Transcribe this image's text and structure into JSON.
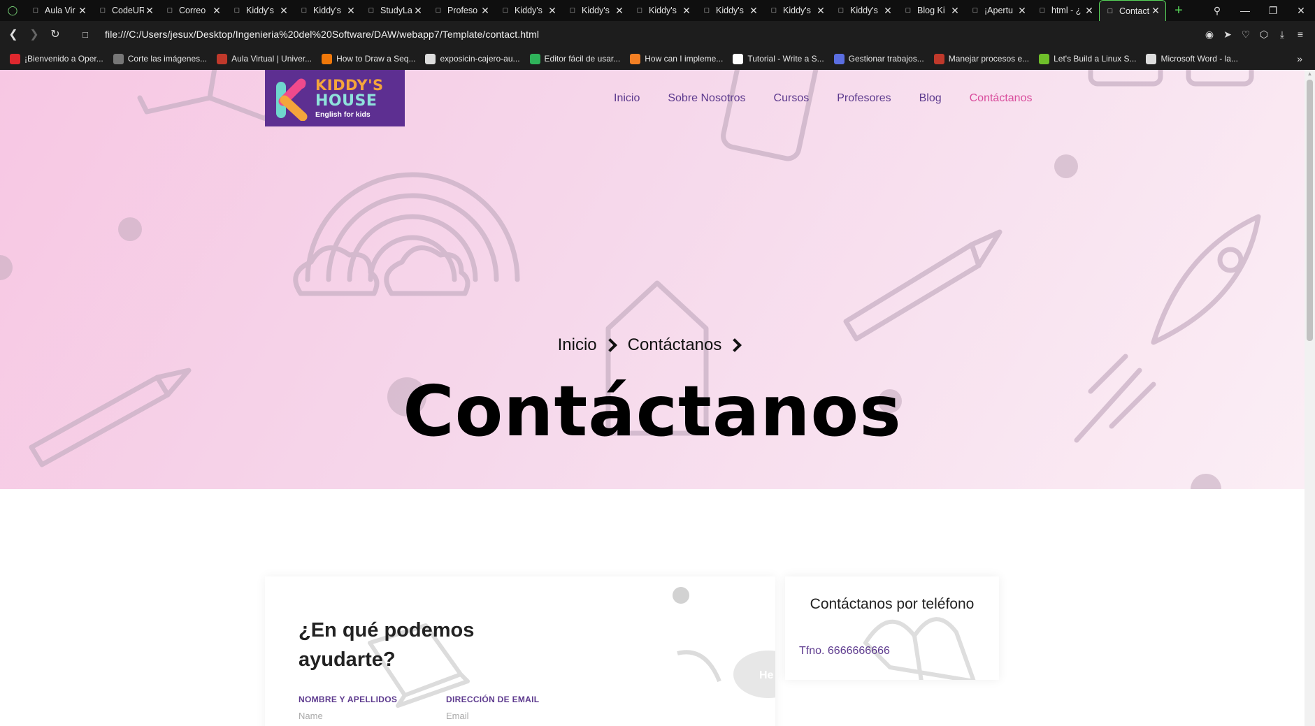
{
  "browser": {
    "tabs": [
      {
        "title": "Aula Vir",
        "icon": "moodle-icon"
      },
      {
        "title": "CodeUR",
        "icon": "github-icon"
      },
      {
        "title": "Correo",
        "icon": "outlook-icon"
      },
      {
        "title": "Kiddy's",
        "icon": "page-icon"
      },
      {
        "title": "Kiddy's",
        "icon": "page-icon"
      },
      {
        "title": "StudyLa",
        "icon": "page-icon"
      },
      {
        "title": "Profeso",
        "icon": "page-icon"
      },
      {
        "title": "Kiddy's",
        "icon": "page-icon"
      },
      {
        "title": "Kiddy's",
        "icon": "page-icon"
      },
      {
        "title": "Kiddy's",
        "icon": "page-icon"
      },
      {
        "title": "Kiddy's",
        "icon": "page-icon"
      },
      {
        "title": "Kiddy's",
        "icon": "page-icon"
      },
      {
        "title": "Kiddy's",
        "icon": "page-icon"
      },
      {
        "title": "Blog Ki",
        "icon": "page-icon"
      },
      {
        "title": "¡Apertu",
        "icon": "page-icon"
      },
      {
        "title": "html - ¿",
        "icon": "stackoverflow-icon"
      },
      {
        "title": "Contact",
        "icon": "page-icon",
        "active": true
      }
    ],
    "url": "file:///C:/Users/jesux/Desktop/Ingenieria%20del%20Software/DAW/webapp7/Template/contact.html",
    "bookmarks": [
      {
        "label": "¡Bienvenido a Oper...",
        "icon": "opera-icon",
        "color": "#e0282e"
      },
      {
        "label": "Corte las imágenes...",
        "icon": "image-icon",
        "color": "#777777"
      },
      {
        "label": "Aula Virtual | Univer...",
        "icon": "moodle-icon",
        "color": "#c0392b"
      },
      {
        "label": "How to Draw a Seq...",
        "icon": "draw-icon",
        "color": "#f0780a"
      },
      {
        "label": "exposicin-cajero-au...",
        "icon": "page-icon",
        "color": "#dddddd"
      },
      {
        "label": "Editor fácil de usar...",
        "icon": "editor-icon",
        "color": "#2fb35a"
      },
      {
        "label": "How can I impleme...",
        "icon": "stackoverflow-icon",
        "color": "#f48024"
      },
      {
        "label": "Tutorial - Write a S...",
        "icon": "tutorial-icon",
        "color": "#ffffff"
      },
      {
        "label": "Gestionar trabajos...",
        "icon": "gestion-icon",
        "color": "#5b6ee1"
      },
      {
        "label": "Manejar procesos e...",
        "icon": "shield-icon",
        "color": "#c0392b"
      },
      {
        "label": "Let's Build a Linux S...",
        "icon": "linux-icon",
        "color": "#6fbf2a"
      },
      {
        "label": "Microsoft Word - la...",
        "icon": "page-icon",
        "color": "#dddddd"
      }
    ]
  },
  "site": {
    "logo": {
      "line1": "KIDDY'S",
      "line2": "HOUSE",
      "line3": "English for kids"
    },
    "nav": {
      "inicio": "Inicio",
      "sobre": "Sobre Nosotros",
      "cursos": "Cursos",
      "profesores": "Profesores",
      "blog": "Blog",
      "contacto": "Contáctanos"
    },
    "breadcrumb": {
      "home": "Inicio",
      "current": "Contáctanos"
    },
    "hero_title": "Contáctanos",
    "form": {
      "title": "¿En qué podemos ayudarte?",
      "name_label": "NOMBRE Y APELLIDOS",
      "name_placeholder": "Name",
      "email_label": "DIRECCIÓN DE EMAIL",
      "email_placeholder": "Email"
    },
    "phone_card": {
      "title": "Contáctanos por teléfono",
      "phone": "Tfno. 6666666666"
    },
    "colors": {
      "brand_purple": "#5d3a8e",
      "active_pink": "#d94c9c",
      "hero_pink": "#f7c7e3"
    }
  }
}
